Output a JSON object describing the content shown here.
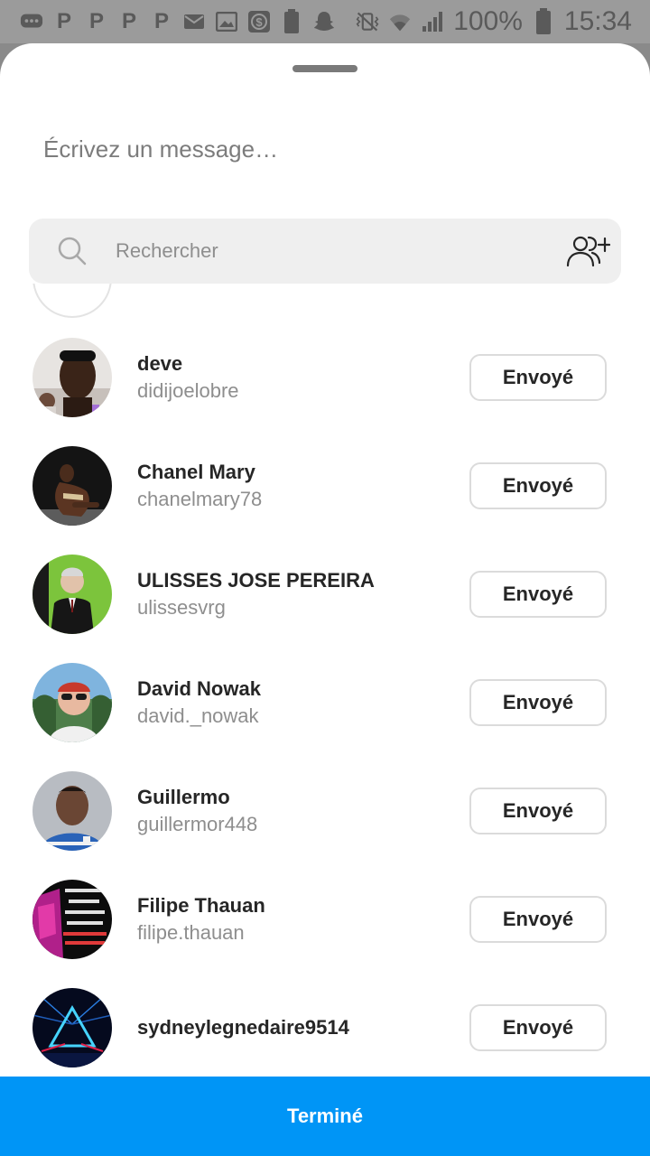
{
  "status_bar": {
    "notification_icons": [
      "chat-bubble-icon",
      "p-icon",
      "p-icon",
      "p-icon",
      "p-icon",
      "mail-icon",
      "image-icon",
      "dollar-icon",
      "battery-100-icon",
      "snapchat-icon"
    ],
    "system_icons": [
      "vibrate-icon",
      "wifi-icon",
      "signal-icon"
    ],
    "p_letter": "P",
    "battery": "100%",
    "time": "15:34"
  },
  "composer": {
    "placeholder": "Écrivez un message…"
  },
  "search": {
    "placeholder": "Rechercher"
  },
  "send_button_label": "Envoyé",
  "recipients": [
    {
      "fullname": "deve",
      "username": "didijoelobre",
      "avatar": "avatar-photo-man"
    },
    {
      "fullname": "Chanel Mary",
      "username": "chanelmary78",
      "avatar": "avatar-photo-woman"
    },
    {
      "fullname": "ULISSES JOSE PEREIRA",
      "username": "ulissesvrg",
      "avatar": "avatar-photo-suit-green"
    },
    {
      "fullname": "David Nowak",
      "username": "david._nowak",
      "avatar": "avatar-photo-sunglasses"
    },
    {
      "fullname": "Guillermo",
      "username": "guillermor448",
      "avatar": "avatar-photo-blue-shirt"
    },
    {
      "fullname": "Filipe Thauan",
      "username": "filipe.thauan",
      "avatar": "avatar-photo-text-image"
    },
    {
      "fullname": "",
      "username": "sydneylegnedaire9514",
      "avatar": "avatar-neon-triangle"
    }
  ],
  "done_button": {
    "label": "Terminé"
  },
  "colors": {
    "accent": "#0095f6",
    "status_bar": "#9b9b9b",
    "search_bg": "#efefef"
  }
}
